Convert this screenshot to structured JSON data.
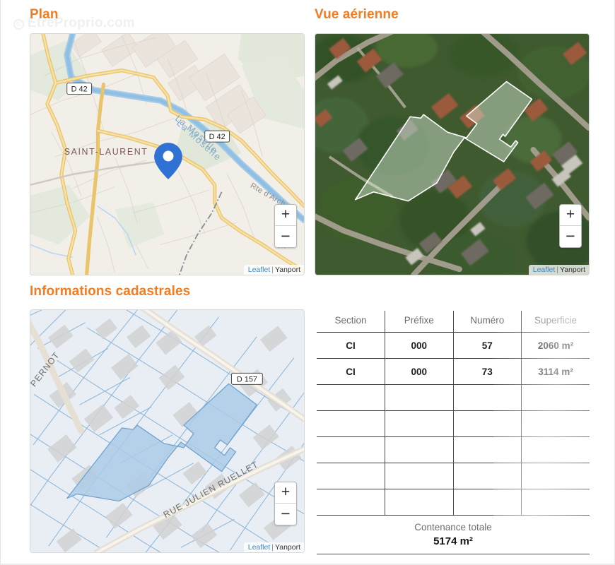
{
  "watermark": {
    "symbol": "©",
    "text": "EtreProprio.com"
  },
  "sections": {
    "plan": {
      "title": "Plan"
    },
    "aerial": {
      "title": "Vue aérienne"
    },
    "cadastral": {
      "title": "Informations cadastrales"
    }
  },
  "maps": {
    "plan": {
      "name": "plan-map",
      "labels": {
        "town": "SAINT-LAURENT",
        "river": "La Moselle",
        "road_shield_1": "D 42",
        "road_shield_2": "D 42",
        "street": "Rte d'Archette",
        "street_partial": "nc"
      },
      "marker": "location-pin",
      "zoom_in": "+",
      "zoom_out": "−",
      "attribution": {
        "provider": "Leaflet",
        "separator": "|",
        "source": "Yanport"
      }
    },
    "aerial": {
      "name": "aerial-map",
      "zoom_in": "+",
      "zoom_out": "−",
      "attribution": {
        "provider": "Leaflet",
        "separator": "|",
        "source": "Yanport"
      }
    },
    "cadastral": {
      "name": "cadastral-map",
      "labels": {
        "street_1": "PERNOT",
        "road_shield": "D 157",
        "street_2": "RUE JULIEN RUELLET"
      },
      "zoom_in": "+",
      "zoom_out": "−",
      "attribution": {
        "provider": "Leaflet",
        "separator": "|",
        "source": "Yanport"
      }
    }
  },
  "cadastral_table": {
    "headers": [
      "Section",
      "Préfixe",
      "Numéro",
      "Superficie"
    ],
    "rows": [
      {
        "section": "CI",
        "prefixe": "000",
        "numero": "57",
        "superficie": "2060 m²"
      },
      {
        "section": "CI",
        "prefixe": "000",
        "numero": "73",
        "superficie": "3114 m²"
      },
      {
        "section": "",
        "prefixe": "",
        "numero": "",
        "superficie": ""
      },
      {
        "section": "",
        "prefixe": "",
        "numero": "",
        "superficie": ""
      },
      {
        "section": "",
        "prefixe": "",
        "numero": "",
        "superficie": ""
      },
      {
        "section": "",
        "prefixe": "",
        "numero": "",
        "superficie": ""
      },
      {
        "section": "",
        "prefixe": "",
        "numero": "",
        "superficie": ""
      }
    ],
    "total_label": "Contenance totale",
    "total_value": "5174 m²"
  },
  "colors": {
    "accent_orange": "#ef7d24",
    "link_blue": "#3a87c8",
    "marker_blue": "#2f72d4",
    "parcel_fill": "#b4d0e8",
    "parcel_line": "#6fa3cf"
  }
}
